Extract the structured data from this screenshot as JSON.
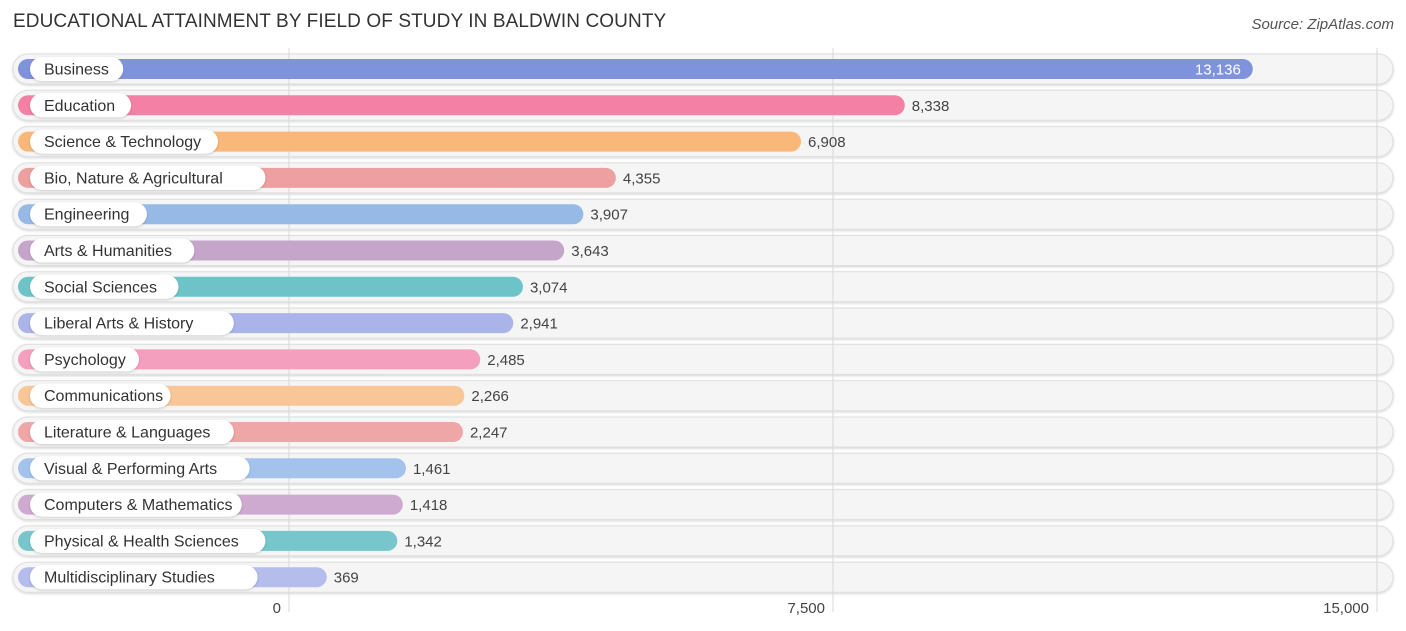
{
  "header": {
    "title": "EDUCATIONAL ATTAINMENT BY FIELD OF STUDY IN BALDWIN COUNTY",
    "source": "Source: ZipAtlas.com"
  },
  "chart_data": {
    "type": "bar",
    "orientation": "horizontal",
    "title": "EDUCATIONAL ATTAINMENT BY FIELD OF STUDY IN BALDWIN COUNTY",
    "xlabel": "",
    "ylabel": "",
    "xlim": [
      0,
      15000
    ],
    "grid": true,
    "x_ticks": [
      0,
      7500,
      15000
    ],
    "x_tick_labels": [
      "0",
      "7,500",
      "15,000"
    ],
    "categories": [
      "Business",
      "Education",
      "Science & Technology",
      "Bio, Nature & Agricultural",
      "Engineering",
      "Arts & Humanities",
      "Social Sciences",
      "Liberal Arts & History",
      "Psychology",
      "Communications",
      "Literature & Languages",
      "Visual & Performing Arts",
      "Computers & Mathematics",
      "Physical & Health Sciences",
      "Multidisciplinary Studies"
    ],
    "values": [
      13136,
      8338,
      6908,
      4355,
      3907,
      3643,
      3074,
      2941,
      2485,
      2266,
      2247,
      1461,
      1418,
      1342,
      369
    ],
    "value_labels": [
      "13,136",
      "8,338",
      "6,908",
      "4,355",
      "3,907",
      "3,643",
      "3,074",
      "2,941",
      "2,485",
      "2,266",
      "2,247",
      "1,461",
      "1,418",
      "1,342",
      "369"
    ],
    "colors": [
      "#7f93dc",
      "#f580a6",
      "#f9b87a",
      "#eca09f",
      "#96b9e5",
      "#c6a5cb",
      "#6ec3c9",
      "#aab4e8",
      "#f59fbe",
      "#f9c697",
      "#efa6a6",
      "#a3c3ec",
      "#cfaad0",
      "#77c6cc",
      "#b5bdec"
    ],
    "legend": "none"
  }
}
